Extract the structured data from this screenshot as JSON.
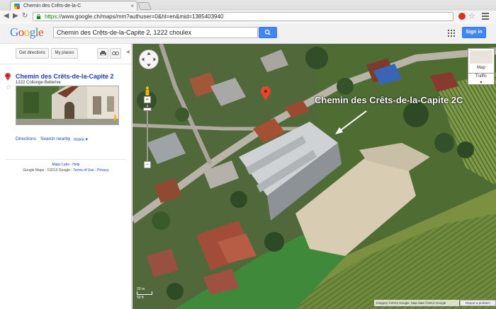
{
  "browser": {
    "tab_title": "Chemin des Crêts-de-la-C",
    "tab_close": "×",
    "url_scheme": "https://",
    "url_rest": "www.google.ch/maps/mm?authuser=0&hl=en&mid=1385403940",
    "back": "◀",
    "forward": "▶",
    "reload": "↻",
    "star": "☆"
  },
  "header": {
    "logo_letters": [
      "G",
      "o",
      "o",
      "g",
      "l",
      "e"
    ],
    "logo_colors": [
      "#4285f4",
      "#ea4335",
      "#fbbc05",
      "#4285f4",
      "#34a853",
      "#ea4335"
    ],
    "search_value": "Chemin des Crêts-de-la-Capite 2, 1222 choulex",
    "signin_label": "Sign in"
  },
  "panel": {
    "get_directions": "Get directions",
    "my_places": "My places",
    "collapse": "◀",
    "place_title": "Chemin des Crêts-de-la-Capite 2",
    "place_address": "1222 Collonge-Bellerive",
    "star": "☆",
    "links": {
      "directions": "Directions",
      "search_nearby": "Search nearby",
      "more": "more ▾"
    },
    "footer_top": "Maps Labs - Help",
    "footer_bottom_plain": "Google Maps - ©2013 Google - ",
    "footer_terms": "Terms of Use",
    "footer_sep": " - ",
    "footer_privacy": "Privacy"
  },
  "map": {
    "annotation": "Chemin des Crêts-de-la-Capite 2C",
    "map_type": "Map",
    "traffic": "Traffic",
    "zoom_plus": "+",
    "zoom_minus": "−",
    "scale_metric": "20 m",
    "scale_imperial": "50 ft",
    "copyright": "Imagery ©2013 Google, Map data ©2013 Google",
    "report": "Report a problem"
  }
}
